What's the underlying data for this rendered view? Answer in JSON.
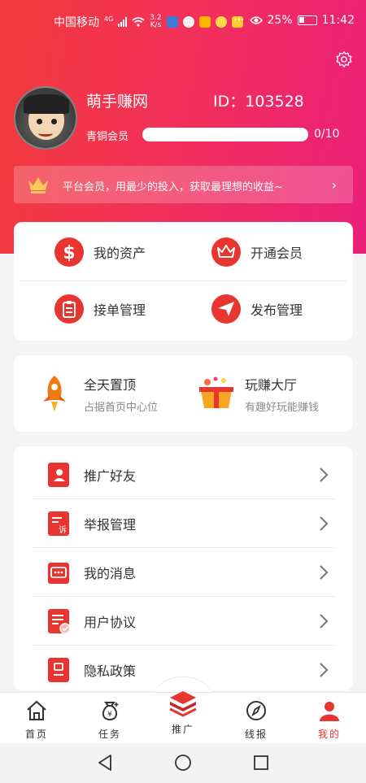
{
  "status_bar": {
    "carrier": "中国移动",
    "network": "4G",
    "speed_value": "3.2",
    "speed_unit": "K/s",
    "more": "···",
    "battery": "25%",
    "time": "11:42"
  },
  "profile": {
    "username": "萌手赚网",
    "id_text": "ID：103528",
    "level": "青铜会员",
    "progress_text": "0/10",
    "progress": 0
  },
  "vip_banner": {
    "text": "平台会员，用最少的投入，获取最理想的收益~"
  },
  "quick_actions": [
    {
      "label": "我的资产",
      "icon": "dollar-icon"
    },
    {
      "label": "开通会员",
      "icon": "crown-icon"
    },
    {
      "label": "接单管理",
      "icon": "clipboard-icon"
    },
    {
      "label": "发布管理",
      "icon": "send-icon"
    }
  ],
  "promos": [
    {
      "title": "全天置顶",
      "subtitle": "占据首页中心位",
      "icon": "rocket-icon"
    },
    {
      "title": "玩赚大厅",
      "subtitle": "有趣好玩能赚钱",
      "icon": "gift-box-icon"
    }
  ],
  "menu": [
    {
      "label": "推广好友",
      "icon": "contact-book-icon"
    },
    {
      "label": "举报管理",
      "icon": "report-icon"
    },
    {
      "label": "我的消息",
      "icon": "message-icon"
    },
    {
      "label": "用户协议",
      "icon": "document-check-icon"
    },
    {
      "label": "隐私政策",
      "icon": "privacy-icon"
    }
  ],
  "tabs": [
    {
      "label": "首页",
      "icon": "home-icon"
    },
    {
      "label": "任务",
      "icon": "money-bag-icon"
    },
    {
      "label": "推广",
      "icon": "promote-icon"
    },
    {
      "label": "线报",
      "icon": "compass-icon"
    },
    {
      "label": "我的",
      "icon": "user-icon"
    }
  ],
  "colors": {
    "accent": "#e8352f",
    "header_start": "#f23a3a",
    "header_end": "#ea1f7a"
  }
}
